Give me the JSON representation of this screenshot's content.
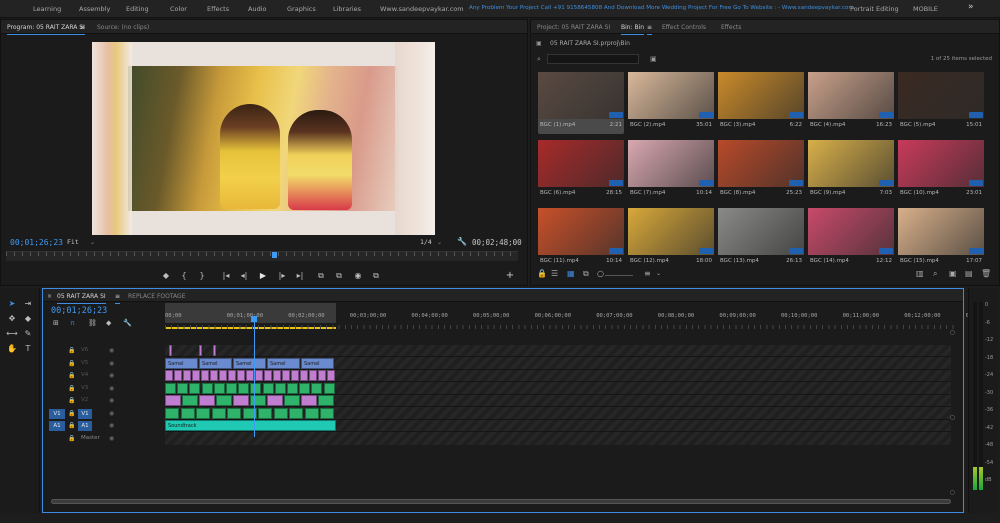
{
  "topbar": {
    "items": [
      "Learning",
      "Assembly",
      "Editing",
      "Color",
      "Effects",
      "Audio",
      "Graphics",
      "Libraries",
      "Www.sandeepvaykar.com"
    ],
    "promo": "Any Problem Your Project Call +91 9158645808 And Download More Wedding Project For Free Go To Website : - Www.sandeepvaykar.com",
    "items_right": [
      "Portrait Editing",
      "MOBILE"
    ],
    "more_icon": "»"
  },
  "program": {
    "tab_program": "Program: 05 RAIT ZARA SI",
    "tab_program_menu": "≡",
    "tab_source": "Source: (no clips)",
    "current_time": "00;01;26;23",
    "fit": "Fit",
    "resolution": "1/4",
    "duration": "00;02;48;00",
    "playhead_progress": 0.52,
    "transport": [
      "◆",
      "{",
      "}",
      "|◂",
      "◂|",
      "▶",
      "|▸",
      "▸|",
      "⧉",
      "⧉",
      "◉",
      "⧉"
    ],
    "add": "+"
  },
  "bin": {
    "tab_project": "Project: 05 RAIT ZARA SI",
    "tab_bin": "Bin: Bin",
    "tab_bin_menu": "≡",
    "tab_effect_controls": "Effect Controls",
    "tab_effects": "Effects",
    "path": "05 RAIT ZARA SI.prproj\\Bin",
    "search_placeholder": "",
    "count": "1 of 25 items selected",
    "items": [
      {
        "name": "BGC (1).mp4",
        "duration": "2:21",
        "color": "#5a4a42",
        "selected": true
      },
      {
        "name": "BGC (2).mp4",
        "duration": "35:01",
        "color": "#d9b89a"
      },
      {
        "name": "BGC (3).mp4",
        "duration": "6:22",
        "color": "#c98a2a"
      },
      {
        "name": "BGC (4).mp4",
        "duration": "16:23",
        "color": "#c9a08a"
      },
      {
        "name": "BGC (5).mp4",
        "duration": "15:01",
        "color": "#3a2a22"
      },
      {
        "name": "BGC (6).mp4",
        "duration": "28:15",
        "color": "#a82a2a"
      },
      {
        "name": "BGC (7).mp4",
        "duration": "10:14",
        "color": "#d8a8b0"
      },
      {
        "name": "BGC (8).mp4",
        "duration": "25:23",
        "color": "#b84a2a"
      },
      {
        "name": "BGC (9).mp4",
        "duration": "7:03",
        "color": "#d8b04a"
      },
      {
        "name": "BGC (10).mp4",
        "duration": "23:01",
        "color": "#c83a5a"
      },
      {
        "name": "BGC (11).mp4",
        "duration": "10:14",
        "color": "#c8502a"
      },
      {
        "name": "BGC (12).mp4",
        "duration": "18:00",
        "color": "#d8a83a"
      },
      {
        "name": "BGC (13).mp4",
        "duration": "26:13",
        "color": "#8a8a88"
      },
      {
        "name": "BGC (14).mp4",
        "duration": "12:12",
        "color": "#c84a6a"
      },
      {
        "name": "BGC (15).mp4",
        "duration": "17:07",
        "color": "#d8b08a"
      }
    ]
  },
  "timeline": {
    "tab_sequence": "05 RAIT ZARA SI",
    "tab_sequence_menu": "≡",
    "tab_replace": "REPLACE FOOTAGE",
    "current_time": "00;01;26;23",
    "ticks": [
      "00;00",
      "00;01;00;00",
      "00;02;00;00",
      "00;03;00;00",
      "00;04;00;00",
      "00;05;00;00",
      "00;06;00;00",
      "00;07;00;00",
      "00;08;00;00",
      "00;09;00;00",
      "00;10;00;00",
      "00;11;00;00",
      "00;12;00;00",
      "00"
    ],
    "tracks": [
      {
        "name": "V6"
      },
      {
        "name": "V5"
      },
      {
        "name": "V4"
      },
      {
        "name": "V3"
      },
      {
        "name": "V2"
      },
      {
        "name": "V1",
        "source": "V1"
      },
      {
        "name": "A1",
        "source": "A1"
      },
      {
        "name": "Master"
      }
    ],
    "title_clip_label": "Samel",
    "audio_clip_label": "Soundtrack"
  },
  "meter": {
    "labels": [
      "0",
      "-6",
      "-12",
      "-18",
      "-24",
      "-30",
      "-36",
      "-42",
      "-48",
      "-54",
      "dB"
    ],
    "level_left": 0.12,
    "level_right": 0.12
  },
  "colors": {
    "accent": "#3e8de0",
    "timecode": "#3e9bf5",
    "video_clip": "#c17ed0",
    "green_clip": "#2fb36a",
    "title_clip": "#6b8bd0",
    "audio_clip": "#1fc9b4",
    "workarea": "#e6c21a"
  }
}
